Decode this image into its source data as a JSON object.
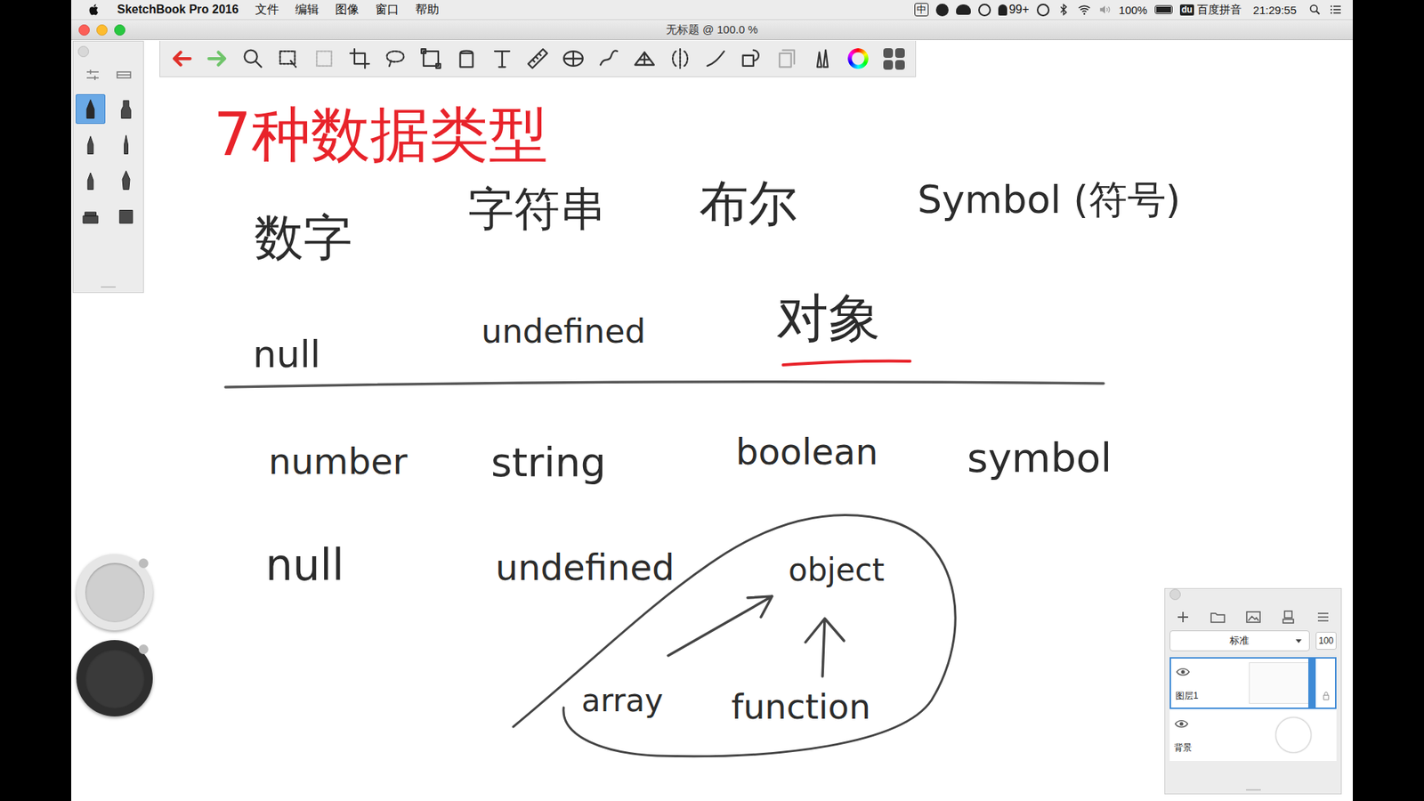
{
  "menubar": {
    "app": "SketchBook Pro 2016",
    "menus": [
      "文件",
      "编辑",
      "图像",
      "窗口",
      "帮助"
    ],
    "input_method": "中",
    "notifications": "99+",
    "battery": "100%",
    "ime_logo": "du",
    "ime_name": "百度拼音",
    "clock": "21:29:55"
  },
  "window": {
    "title": "无标题 @ 100.0 %"
  },
  "brushes": [
    {
      "selected": true
    },
    {
      "selected": false
    },
    {
      "selected": false
    },
    {
      "selected": false
    },
    {
      "selected": false
    },
    {
      "selected": false
    },
    {
      "selected": false
    },
    {
      "selected": false
    }
  ],
  "color_pucks": [
    {
      "color": "#cfcfcf"
    },
    {
      "color": "#3a3a3a"
    }
  ],
  "canvas": {
    "underline_color": "#e8232a",
    "notes": [
      {
        "text": "7种数据类型",
        "color": "#e8232a"
      },
      {
        "text": "数字",
        "color": "#2b2b2b"
      },
      {
        "text": "字符串",
        "color": "#2b2b2b"
      },
      {
        "text": "布尔",
        "color": "#2b2b2b"
      },
      {
        "text": "Symbol (符号)",
        "color": "#2b2b2b"
      },
      {
        "text": "null",
        "color": "#2b2b2b"
      },
      {
        "text": "undefined",
        "color": "#2b2b2b"
      },
      {
        "text": "对象",
        "color": "#2b2b2b"
      },
      {
        "text": "number",
        "color": "#2b2b2b"
      },
      {
        "text": "string",
        "color": "#2b2b2b"
      },
      {
        "text": "boolean",
        "color": "#2b2b2b"
      },
      {
        "text": "symbol",
        "color": "#2b2b2b"
      },
      {
        "text": "null",
        "color": "#2b2b2b"
      },
      {
        "text": "undefined",
        "color": "#2b2b2b"
      },
      {
        "text": "object",
        "color": "#2b2b2b"
      },
      {
        "text": "array",
        "color": "#2b2b2b"
      },
      {
        "text": "function",
        "color": "#2b2b2b"
      }
    ]
  },
  "layers": {
    "blend_mode": "标准",
    "opacity": "100",
    "items": [
      {
        "name": "图层1",
        "visible": true,
        "selected": true
      },
      {
        "name": "背景",
        "visible": true,
        "selected": false
      }
    ]
  }
}
